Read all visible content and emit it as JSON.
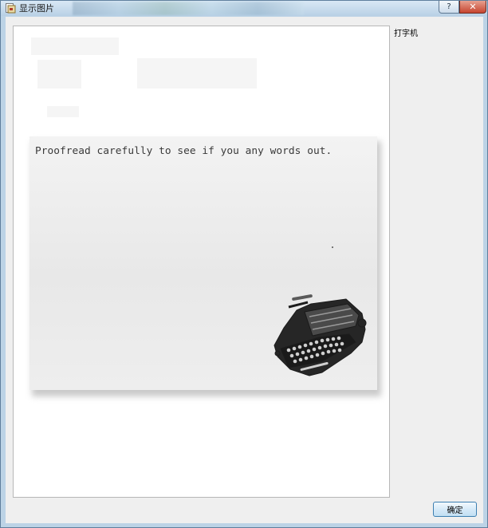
{
  "window": {
    "title": "显示图片"
  },
  "titlebar": {
    "help_label": "?",
    "close_label": "✕"
  },
  "image": {
    "card_text": "Proofread carefully to see if you any words out."
  },
  "caption": "打字机",
  "buttons": {
    "ok_label": "确定"
  },
  "colors": {
    "titlebar": "#c8dced",
    "client": "#efefef",
    "close": "#c7452f",
    "ok_border": "#3c7fb1"
  }
}
